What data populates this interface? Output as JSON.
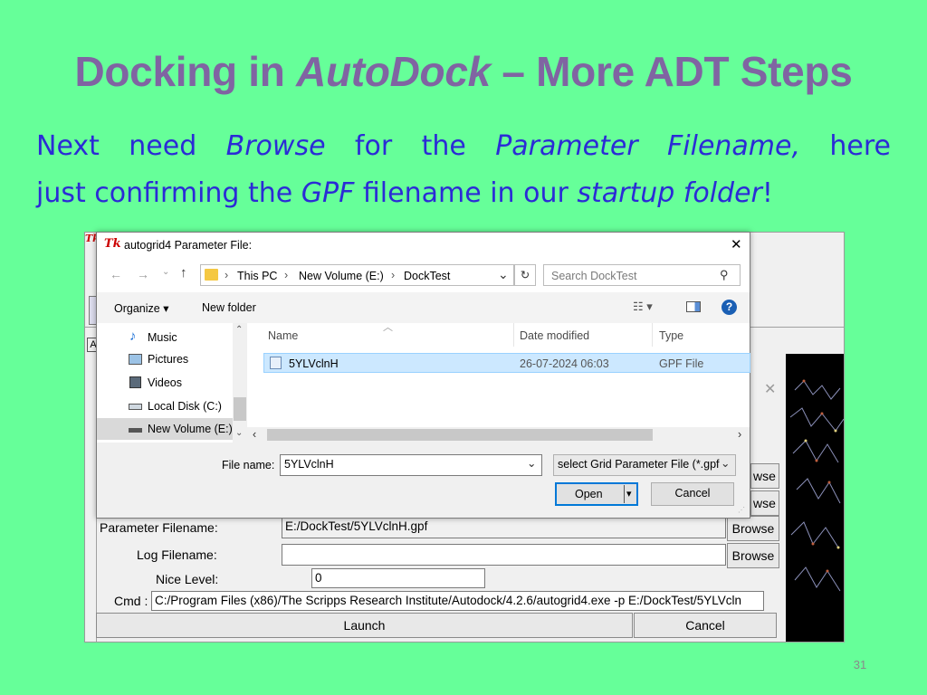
{
  "slide": {
    "title_part1": "Docking in ",
    "title_italic": "AutoDock",
    "title_part2": " – More ADT Steps",
    "body_l1_a": "Next need ",
    "body_l1_b": "Browse",
    "body_l1_c": " for the ",
    "body_l1_d": "Parameter Filename,",
    "body_l1_e": " here",
    "body_l2_a": "just confirming the ",
    "body_l2_b": "GPF",
    "body_l2_c": " filename in our ",
    "body_l2_d": "startup folder",
    "body_l2_e": "!",
    "page_number": "31"
  },
  "dialog": {
    "title": "autogrid4 Parameter File:",
    "tk_logo": "Tk",
    "close_glyph": "✕",
    "breadcrumb": [
      "This PC",
      "New Volume (E:)",
      "DockTest"
    ],
    "search_placeholder": "Search DockTest",
    "organize_label": "Organize ▾",
    "new_folder_label": "New folder",
    "nav_items": [
      {
        "label": "Music",
        "icon": "music-icon"
      },
      {
        "label": "Pictures",
        "icon": "pictures-icon"
      },
      {
        "label": "Videos",
        "icon": "videos-icon"
      },
      {
        "label": "Local Disk (C:)",
        "icon": "drive-icon"
      },
      {
        "label": "New Volume (E:)",
        "icon": "drive-icon"
      }
    ],
    "columns": {
      "name": "Name",
      "date": "Date modified",
      "type": "Type"
    },
    "files": [
      {
        "name": "5YLVclnH",
        "date": "26-07-2024 06:03",
        "type": "GPF File"
      }
    ],
    "filename_label": "File name:",
    "filename_value": "5YLVclnH",
    "filter_value": "select Grid Parameter File (*.gpf",
    "open_label": "Open",
    "cancel_label": "Cancel"
  },
  "tk_form": {
    "browse_label_1": "wse",
    "browse_label_2": "wse",
    "param_label": "Parameter Filename:",
    "param_value": "E:/DockTest/5YLVclnH.gpf",
    "log_label": "Log Filename:",
    "log_value": "",
    "browse_label": "Browse",
    "nice_label": "Nice Level:",
    "nice_value": "0",
    "cmd_label": "Cmd :",
    "cmd_value": "C:/Program Files (x86)/The Scripps Research Institute/Autodock/4.2.6/autogrid4.exe -p E:/DockTest/5YLVcln",
    "launch_label": "Launch",
    "cancel_label": "Cancel",
    "tk_logo": "Tk",
    "small_label": "A",
    "close_glyph": "✕"
  }
}
